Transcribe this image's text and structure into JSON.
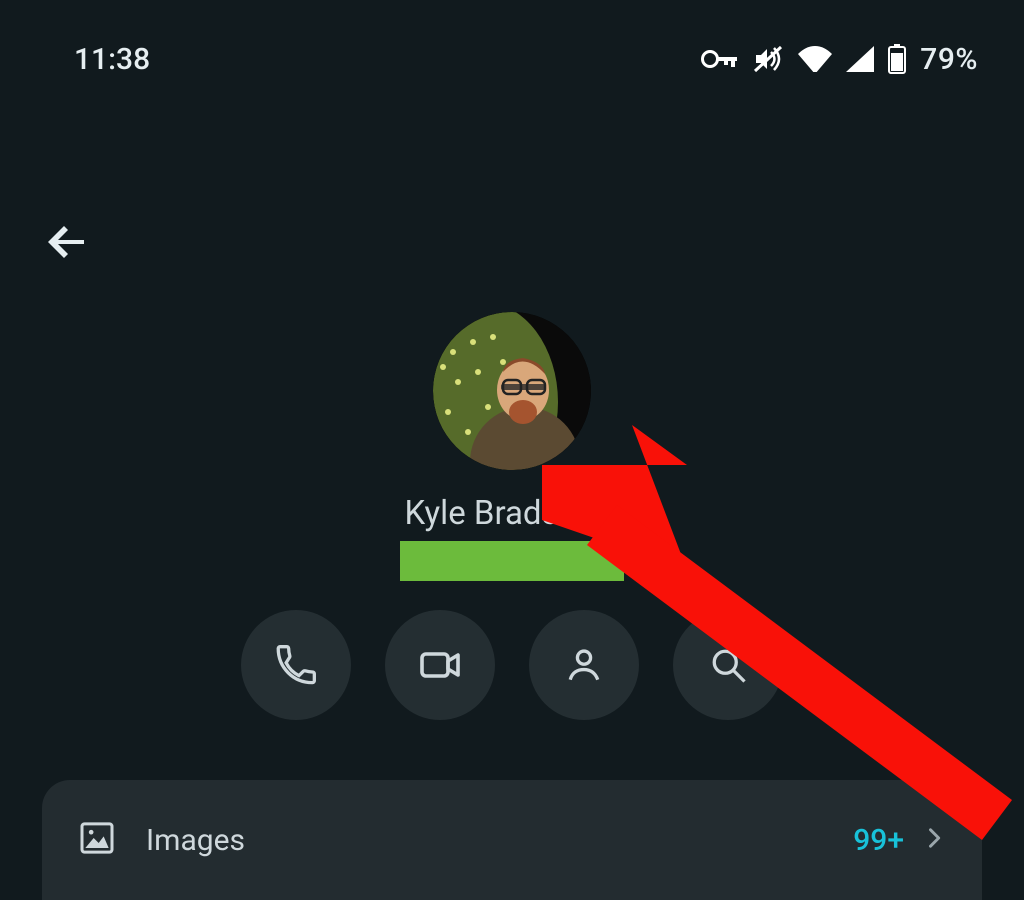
{
  "status": {
    "time": "11:38",
    "battery_text": "79%",
    "icons": {
      "vpn": "vpn-key-icon",
      "mute": "mute-icon",
      "wifi": "wifi-icon",
      "cell": "cell-signal-icon",
      "battery": "battery-icon"
    }
  },
  "contact": {
    "name": "Kyle Bradshaw"
  },
  "actions": {
    "call": "phone-icon",
    "video": "video-icon",
    "profile": "person-icon",
    "search": "search-icon"
  },
  "images_row": {
    "label": "Images",
    "count": "99+"
  },
  "colors": {
    "accent": "#18c2d9",
    "redaction": "#6cbb3c",
    "annotation": "#f91108"
  }
}
